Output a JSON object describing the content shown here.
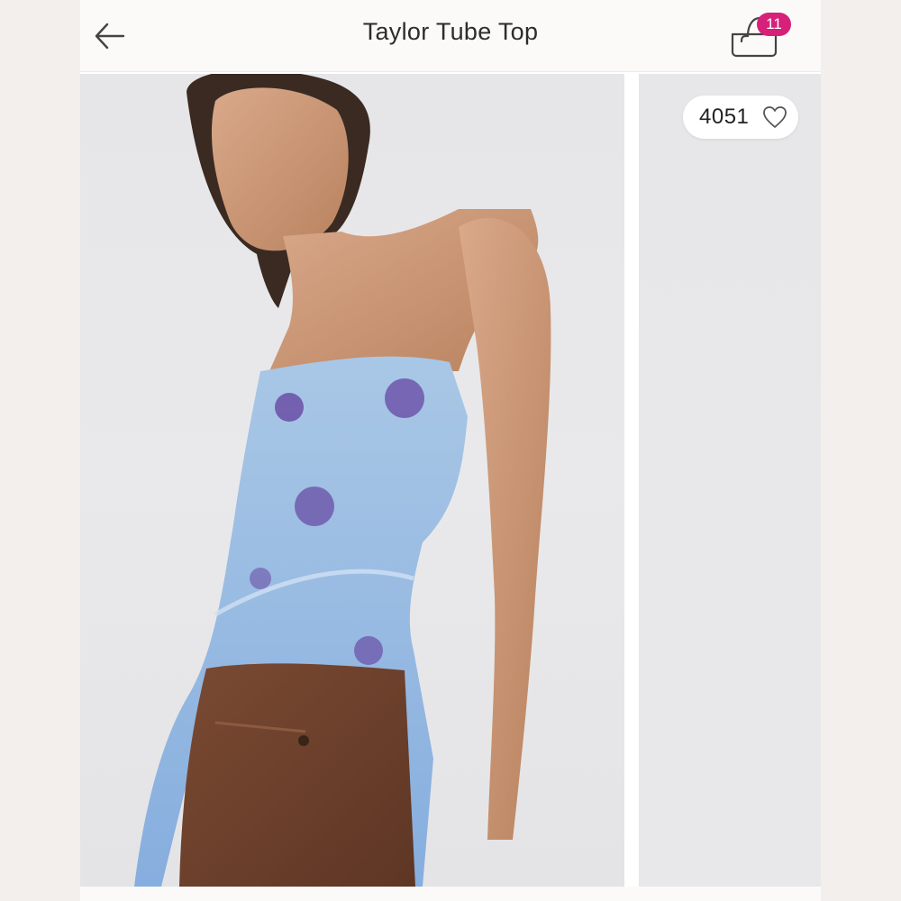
{
  "header": {
    "title": "Taylor Tube Top",
    "back_icon": "arrow-left-icon",
    "bag_icon": "shopping-bag-icon",
    "bag_count": "11"
  },
  "gallery": {
    "main_image": "model wearing blue floral strapless mesh ruffle tube top with brown denim",
    "like_count": "4051",
    "like_icon": "heart-outline-icon"
  },
  "colors": {
    "badge": "#d6207a",
    "header_bg": "#fbfaf8",
    "text": "#2c2c2c"
  }
}
